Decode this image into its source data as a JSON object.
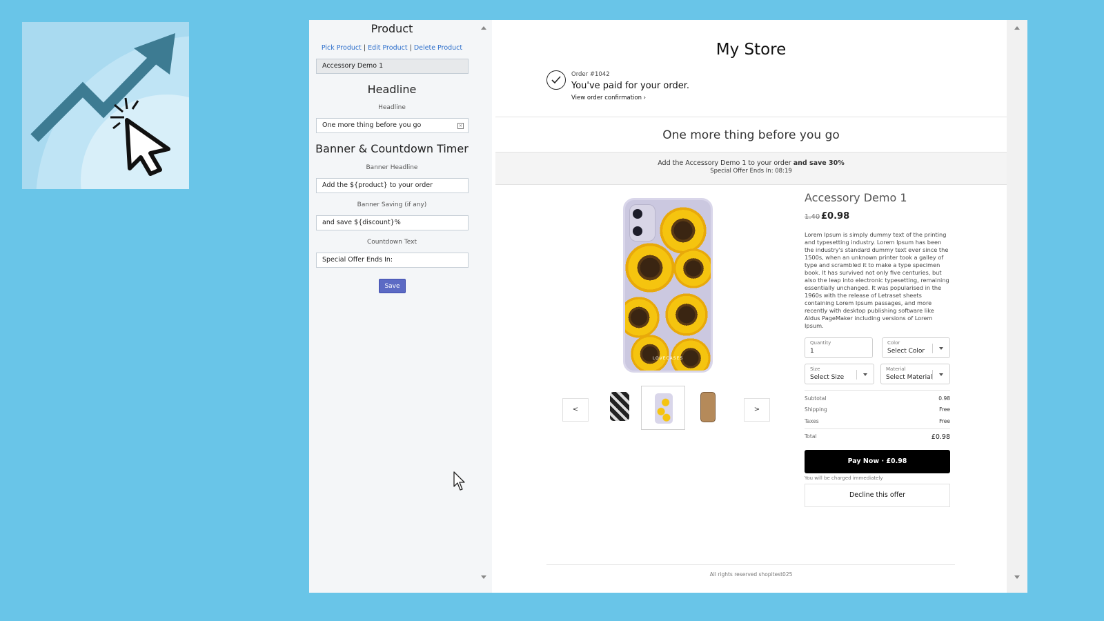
{
  "colors": {
    "background": "#69c5e8",
    "accent": "#5c6ac4",
    "link": "#2c6ecb",
    "pay_button": "#000000"
  },
  "panel": {
    "product_title": "Product",
    "links": {
      "pick": "Pick Product",
      "sep1": " | ",
      "edit": "Edit Product",
      "sep2": " | ",
      "delete": "Delete Product"
    },
    "product_value": "Accessory Demo 1",
    "headline_title": "Headline",
    "headline_label": "Headline",
    "headline_value": "One more thing before you go",
    "banner_title": "Banner & Countdown Timer",
    "banner_headline_label": "Banner Headline",
    "banner_headline_value": "Add the ${product} to your order",
    "banner_saving_label": "Banner Saving (if any)",
    "banner_saving_value": "and save ${discount}%",
    "countdown_label": "Countdown Text",
    "countdown_value": "Special Offer Ends In:",
    "save_label": "Save"
  },
  "preview": {
    "store_title": "My Store",
    "order_number": "Order #1042",
    "paid_text": "You've paid for your order.",
    "view_confirmation": "View order confirmation ›",
    "headline": "One more thing before you go",
    "banner_text": "Add the Accessory Demo 1 to your order",
    "banner_saving": "and save 30%",
    "countdown": "Special Offer Ends In: 08:19",
    "product_name": "Accessory Demo 1",
    "price_old": "1.40",
    "price_new": "£0.98",
    "description": "Lorem Ipsum is simply dummy text of the printing and typesetting industry. Lorem Ipsum has been the industry's standard dummy text ever since the 1500s, when an unknown printer took a galley of type and scrambled it to make a type specimen book. It has survived not only five centuries, but also the leap into electronic typesetting, remaining essentially unchanged. It was popularised in the 1960s with the release of Letraset sheets containing Lorem Ipsum passages, and more recently with desktop publishing software like Aldus PageMaker including versions of Lorem Ipsum.",
    "phone_brand": "LOVECASES",
    "prev_label": "<",
    "next_label": ">",
    "quantity": {
      "label": "Quantity",
      "value": "1"
    },
    "color": {
      "label": "Color",
      "value": "Select Color"
    },
    "size": {
      "label": "Size",
      "value": "Select Size"
    },
    "material": {
      "label": "Material",
      "value": "Select Material"
    },
    "summary": {
      "subtotal_label": "Subtotal",
      "subtotal_value": "0.98",
      "shipping_label": "Shipping",
      "shipping_value": "Free",
      "taxes_label": "Taxes",
      "taxes_value": "Free",
      "total_label": "Total",
      "total_value": "£0.98"
    },
    "pay_label": "Pay Now · £0.98",
    "charged_note": "You will be charged immediately",
    "decline_label": "Decline this offer",
    "footer": "All rights reserved shopitest025"
  }
}
